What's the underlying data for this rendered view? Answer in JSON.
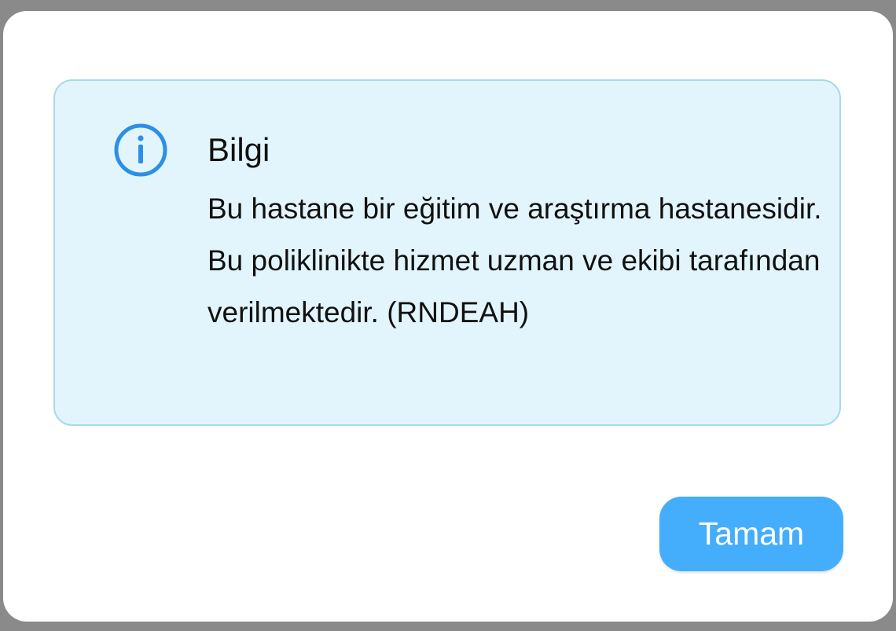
{
  "dialog": {
    "info": {
      "icon": "info-circle-icon",
      "title": "Bilgi",
      "body": "Bu hastane bir eğitim ve araştırma hastanesidir. Bu poliklinikte hizmet uzman ve ekibi tarafından verilmektedir. (RNDEAH)"
    },
    "ok_label": "Tamam"
  },
  "colors": {
    "backdrop": "#8a8a8a",
    "info_background": "#e3f5fc",
    "info_border": "#a6d9f0",
    "info_icon": "#2b8fe6",
    "button": "#45aefc"
  }
}
